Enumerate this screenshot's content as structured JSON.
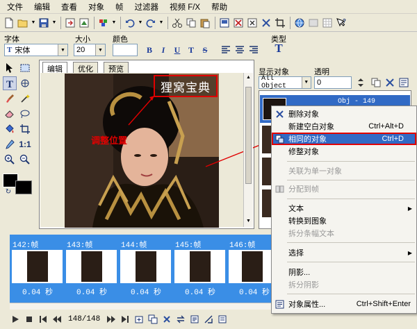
{
  "menubar": {
    "items": [
      "文件",
      "编辑",
      "查看",
      "对象",
      "帧",
      "过滤器",
      "视频 F/X",
      "帮助"
    ]
  },
  "toolbar": {
    "icons": [
      "new-file-icon",
      "open-folder-icon",
      "save-icon",
      "import-icon",
      "export-icon",
      "color-icon",
      "undo-icon",
      "redo-icon",
      "cut-icon",
      "copy-icon",
      "paste-icon",
      "frame-icon",
      "delete-icon",
      "scissors-icon",
      "close-icon",
      "crop-icon",
      "web-icon",
      "disabled-icon",
      "grid-icon",
      "help-icon"
    ]
  },
  "formatbar": {
    "font_label": "字体",
    "font_value": "宋体",
    "size_label": "大小",
    "size_value": "20",
    "color_label": "颜色",
    "type_label": "类型",
    "format_buttons": [
      "B",
      "I",
      "U",
      "T",
      "S"
    ]
  },
  "canvas": {
    "tabs": [
      "编辑",
      "优化",
      "预览"
    ],
    "overlay_text": "狸窝宝典",
    "annotation_text": "调整位置",
    "colors": {
      "annotation": "#e00000",
      "highlight_border": "#e00000"
    }
  },
  "objects_panel": {
    "display_label": "显示对象",
    "display_value": "All Object",
    "opacity_label": "透明",
    "opacity_value": "0",
    "selected_object": "Obj - 149"
  },
  "filmstrip": {
    "frames": [
      {
        "label": "142:帧",
        "time": "0.04 秒"
      },
      {
        "label": "143:帧",
        "time": "0.04 秒"
      },
      {
        "label": "144:帧",
        "time": "0.04 秒"
      },
      {
        "label": "145:帧",
        "time": "0.04 秒"
      },
      {
        "label": "146:帧",
        "time": "0.04 秒"
      }
    ],
    "color": "#3a8ee6"
  },
  "playbar": {
    "counter": "148/148"
  },
  "context_menu": {
    "items": [
      {
        "label": "删除对象",
        "shortcut": "",
        "icon": "delete-x-icon",
        "disabled": false
      },
      {
        "label": "新建空白对象",
        "shortcut": "Ctrl+Alt+D",
        "icon": "",
        "disabled": false
      },
      {
        "label": "相同的对象",
        "shortcut": "Ctrl+D",
        "icon": "duplicate-icon",
        "disabled": false,
        "highlighted": true
      },
      {
        "label": "修整对象",
        "shortcut": "",
        "icon": "",
        "disabled": false
      },
      {
        "label": "关联为单一对象",
        "shortcut": "",
        "icon": "",
        "disabled": true
      },
      {
        "label": "分配到帧",
        "shortcut": "",
        "icon": "distribute-icon",
        "disabled": true
      },
      {
        "label": "文本",
        "shortcut": "",
        "icon": "",
        "disabled": false,
        "submenu": true
      },
      {
        "label": "转换到图象",
        "shortcut": "",
        "icon": "",
        "disabled": false
      },
      {
        "label": "拆分条幅文本",
        "shortcut": "",
        "icon": "",
        "disabled": true
      },
      {
        "label": "选择",
        "shortcut": "",
        "icon": "",
        "disabled": false,
        "submenu": true
      },
      {
        "label": "阴影...",
        "shortcut": "",
        "icon": "",
        "disabled": false
      },
      {
        "label": "拆分阴影",
        "shortcut": "",
        "icon": "",
        "disabled": true
      },
      {
        "label": "对象属性...",
        "shortcut": "Ctrl+Shift+Enter",
        "icon": "properties-icon",
        "disabled": false
      }
    ],
    "highlight_color": "#316ac5"
  }
}
